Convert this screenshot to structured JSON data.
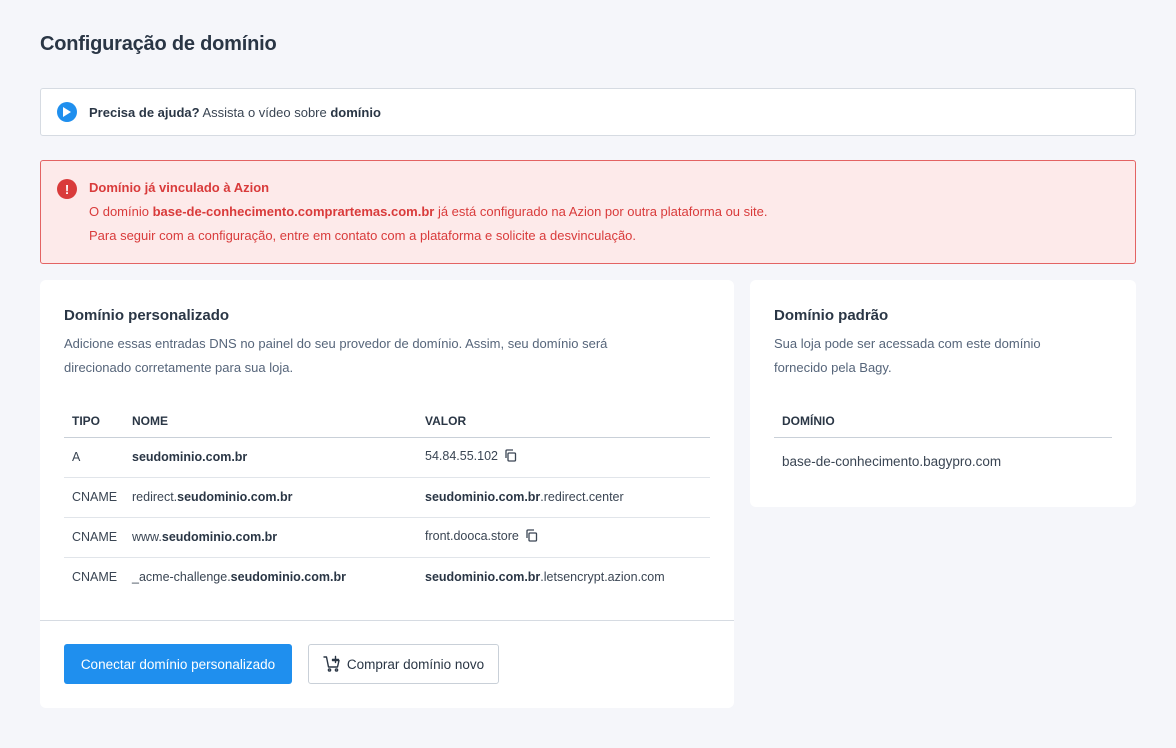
{
  "page": {
    "title": "Configuração de domínio"
  },
  "help": {
    "bold": "Precisa de ajuda?",
    "text": " Assista o vídeo sobre ",
    "link": "domínio"
  },
  "alert": {
    "title": "Domínio já vinculado à Azion",
    "line1_pre": "O domínio ",
    "line1_domain": "base-de-conhecimento.comprartemas.com.br",
    "line1_post": " já está configurado na Azion por outra plataforma ou site.",
    "line2": "Para seguir com a configuração, entre em contato com a plataforma e solicite a desvinculação."
  },
  "custom": {
    "title": "Domínio personalizado",
    "desc1": "Adicione essas entradas DNS no painel do seu provedor de domínio. Assim, seu domínio será",
    "desc2": "direcionado corretamente para sua loja.",
    "headers": {
      "type": "TIPO",
      "name": "NOME",
      "value": "VALOR"
    },
    "rows": [
      {
        "type": "A",
        "name_pre": "",
        "name_bold": "seudominio.com.br",
        "value_bold": "",
        "value_rest": "54.84.55.102",
        "copy": true
      },
      {
        "type": "CNAME",
        "name_pre": "redirect.",
        "name_bold": "seudominio.com.br",
        "value_bold": "seudominio.com.br",
        "value_rest": ".redirect.center",
        "copy": false
      },
      {
        "type": "CNAME",
        "name_pre": "www.",
        "name_bold": "seudominio.com.br",
        "value_bold": "",
        "value_rest": "front.dooca.store",
        "copy": true
      },
      {
        "type": "CNAME",
        "name_pre": "_acme-challenge.",
        "name_bold": "seudominio.com.br",
        "value_bold": "seudominio.com.br",
        "value_rest": ".letsencrypt.azion.com",
        "copy": false
      }
    ],
    "connect_button": "Conectar domínio personalizado",
    "buy_button": "Comprar domínio novo"
  },
  "default": {
    "title": "Domínio padrão",
    "desc1": "Sua loja pode ser acessada com este domínio",
    "desc2": "fornecido pela Bagy.",
    "header": "DOMÍNIO",
    "domain": "base-de-conhecimento.bagypro.com"
  },
  "colors": {
    "accent": "#1f8fee",
    "error": "#d93b3b",
    "error_bg": "#fdeaea"
  },
  "icons": {
    "help": "play-icon",
    "alert": "alert-icon",
    "copy": "copy-icon",
    "cart": "cart-icon"
  }
}
